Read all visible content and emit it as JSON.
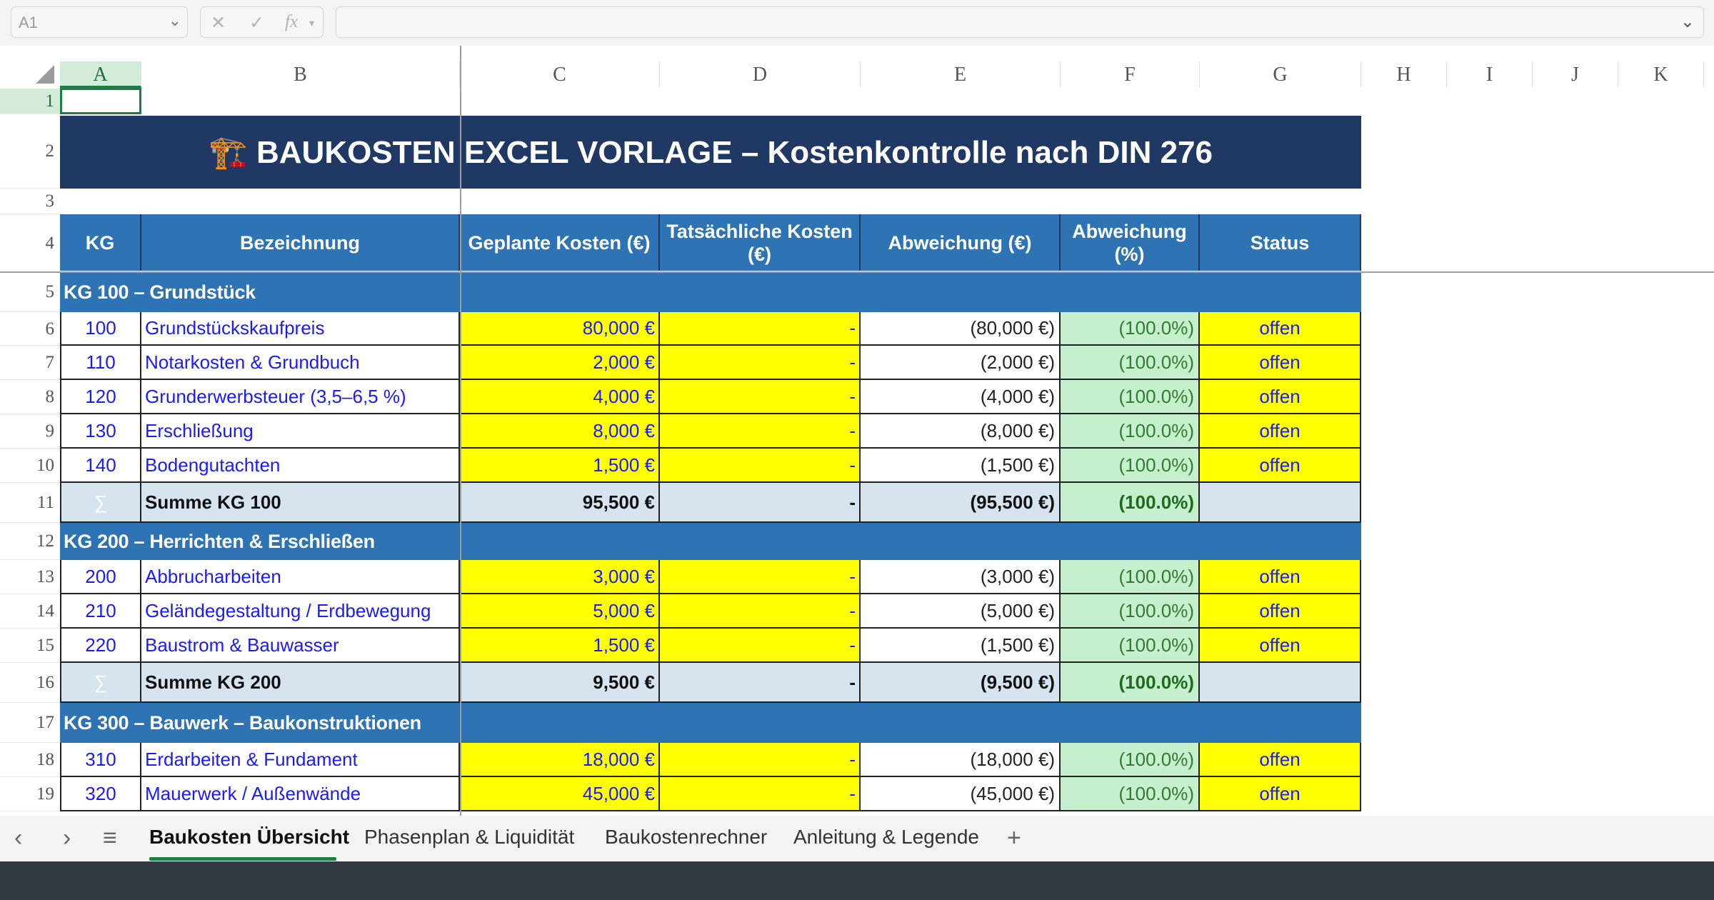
{
  "formula_bar": {
    "name_box": "A1",
    "chevron": "⌄",
    "cancel_icon": "✕",
    "confirm_icon": "✓",
    "fx_icon": "fx",
    "formula_value": ""
  },
  "columns": [
    "A",
    "B",
    "C",
    "D",
    "E",
    "F",
    "G",
    "H",
    "I",
    "J",
    "K"
  ],
  "rows": [
    "1",
    "2",
    "3",
    "4",
    "5",
    "6",
    "7",
    "8",
    "9",
    "10",
    "11",
    "12",
    "13",
    "14",
    "15",
    "16",
    "17",
    "18",
    "19"
  ],
  "sheet": {
    "title": "🏗️  BAUKOSTEN EXCEL VORLAGE  –  Kostenkontrolle nach DIN 276",
    "headers": [
      "KG",
      "Bezeichnung",
      "Geplante Kosten (€)",
      "Tatsächliche Kosten (€)",
      "Abweichung (€)",
      "Abweichung (%)",
      "Status"
    ],
    "sections": [
      {
        "label": "KG 100 – Grundstück",
        "items": [
          {
            "kg": "100",
            "name": "Grundstückskaufpreis",
            "planned": "80,000 €",
            "actual": "-",
            "dev": "(80,000 €)",
            "pct": "(100.0%)",
            "status": "offen"
          },
          {
            "kg": "110",
            "name": "Notarkosten & Grundbuch",
            "planned": "2,000 €",
            "actual": "-",
            "dev": "(2,000 €)",
            "pct": "(100.0%)",
            "status": "offen"
          },
          {
            "kg": "120",
            "name": "Grunderwerbsteuer (3,5–6,5 %)",
            "planned": "4,000 €",
            "actual": "-",
            "dev": "(4,000 €)",
            "pct": "(100.0%)",
            "status": "offen"
          },
          {
            "kg": "130",
            "name": "Erschließung",
            "planned": "8,000 €",
            "actual": "-",
            "dev": "(8,000 €)",
            "pct": "(100.0%)",
            "status": "offen"
          },
          {
            "kg": "140",
            "name": "Bodengutachten",
            "planned": "1,500 €",
            "actual": "-",
            "dev": "(1,500 €)",
            "pct": "(100.0%)",
            "status": "offen"
          }
        ],
        "sum": {
          "kg": "∑",
          "name": "Summe KG 100",
          "planned": "95,500 €",
          "actual": "-",
          "dev": "(95,500 €)",
          "pct": "(100.0%)"
        }
      },
      {
        "label": "KG 200 – Herrichten & Erschließen",
        "items": [
          {
            "kg": "200",
            "name": "Abbrucharbeiten",
            "planned": "3,000 €",
            "actual": "-",
            "dev": "(3,000 €)",
            "pct": "(100.0%)",
            "status": "offen"
          },
          {
            "kg": "210",
            "name": "Geländegestaltung / Erdbewegung",
            "planned": "5,000 €",
            "actual": "-",
            "dev": "(5,000 €)",
            "pct": "(100.0%)",
            "status": "offen"
          },
          {
            "kg": "220",
            "name": "Baustrom & Bauwasser",
            "planned": "1,500 €",
            "actual": "-",
            "dev": "(1,500 €)",
            "pct": "(100.0%)",
            "status": "offen"
          }
        ],
        "sum": {
          "kg": "∑",
          "name": "Summe KG 200",
          "planned": "9,500 €",
          "actual": "-",
          "dev": "(9,500 €)",
          "pct": "(100.0%)"
        }
      },
      {
        "label": "KG 300 – Bauwerk – Baukonstruktionen",
        "items": [
          {
            "kg": "310",
            "name": "Erdarbeiten & Fundament",
            "planned": "18,000 €",
            "actual": "-",
            "dev": "(18,000 €)",
            "pct": "(100.0%)",
            "status": "offen"
          },
          {
            "kg": "320",
            "name": "Mauerwerk / Außenwände",
            "planned": "45,000 €",
            "actual": "-",
            "dev": "(45,000 €)",
            "pct": "(100.0%)",
            "status": "offen"
          }
        ]
      }
    ]
  },
  "tabs": {
    "prev_icon": "‹",
    "next_icon": "›",
    "menu_icon": "≡",
    "add_icon": "+",
    "items": [
      "Baukosten Übersicht",
      "Phasenplan & Liquidität",
      "Baukostenrechner",
      "Anleitung & Legende"
    ],
    "active": "Baukosten Übersicht"
  },
  "colors": {
    "title_bg": "#1f3864",
    "header_bg": "#2e74b5",
    "input_yellow": "#ffff00",
    "pct_green": "#c6efce",
    "sum_bg": "#d6e4f0",
    "input_blue_text": "#1a1aff",
    "selection_green": "#1e7c45"
  }
}
